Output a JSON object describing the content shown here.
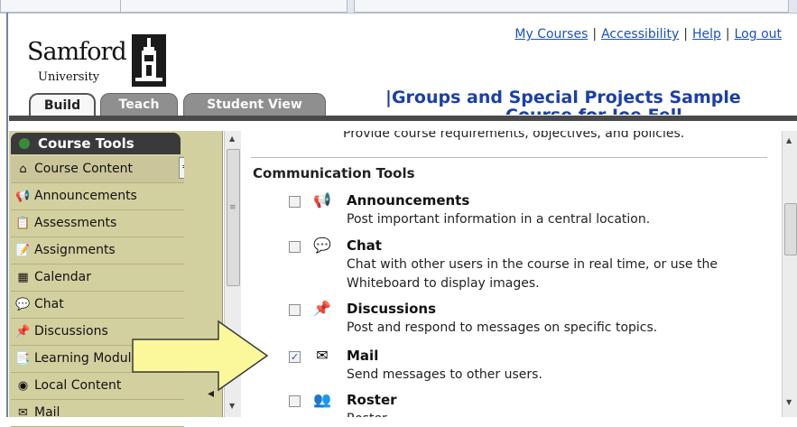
{
  "header": {
    "logo_text": "Samford",
    "logo_subtext": "University",
    "links": [
      "My Courses",
      "Accessibility",
      "Help",
      "Log out"
    ],
    "course_title": "|Groups and Special Projects Sample",
    "course_title_overflow": "Course for Joe Fell"
  },
  "mode_tabs": [
    {
      "label": "Build"
    },
    {
      "label": "Teach"
    },
    {
      "label": "Student View"
    }
  ],
  "nav": {
    "header": "Course Tools",
    "items": [
      {
        "label": "Course Content",
        "icon": "home-icon",
        "glyph": "⌂"
      },
      {
        "label": "Announcements",
        "icon": "megaphone-icon",
        "glyph": "📢"
      },
      {
        "label": "Assessments",
        "icon": "assessment-icon",
        "glyph": "📋"
      },
      {
        "label": "Assignments",
        "icon": "assignment-icon",
        "glyph": "📝"
      },
      {
        "label": "Calendar",
        "icon": "calendar-icon",
        "glyph": "▦"
      },
      {
        "label": "Chat",
        "icon": "chat-icon",
        "glyph": "💬"
      },
      {
        "label": "Discussions",
        "icon": "pushpin-icon",
        "glyph": "📌"
      },
      {
        "label": "Learning Modules",
        "icon": "module-icon",
        "glyph": "📑"
      },
      {
        "label": "Local Content",
        "icon": "disc-icon",
        "glyph": "◉"
      },
      {
        "label": "Mail",
        "icon": "mail-icon",
        "glyph": "✉"
      }
    ],
    "collapse_glyph": "≚"
  },
  "main": {
    "top_line": "Provide course requirements, objectives, and policies.",
    "section_heading": "Communication Tools",
    "tools": [
      {
        "name": "Announcements",
        "desc": "Post important information in a central location.",
        "checked": false,
        "icon": "megaphone-icon",
        "glyph": "📢"
      },
      {
        "name": "Chat",
        "desc": "Chat with other users in the course in real time, or use the Whiteboard to display images.",
        "checked": false,
        "icon": "chat-icon",
        "glyph": "💬"
      },
      {
        "name": "Discussions",
        "desc": "Post and respond to messages on specific topics.",
        "checked": false,
        "icon": "pushpin-icon",
        "glyph": "📌"
      },
      {
        "name": "Mail",
        "desc": "Send messages to other users.",
        "checked": true,
        "icon": "mail-icon",
        "glyph": "✉"
      },
      {
        "name": "Roster",
        "desc": "Roster",
        "checked": false,
        "icon": "roster-icon",
        "glyph": "👥"
      }
    ]
  },
  "colors": {
    "nav_bg": "#d3d0a0",
    "link": "#1a4fc7",
    "title": "#1a3fa8",
    "arrow_fill": "#fbf89c"
  }
}
